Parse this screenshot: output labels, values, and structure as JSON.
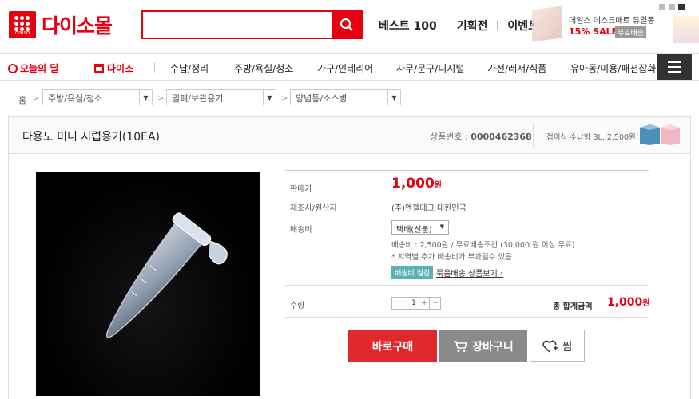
{
  "header": {
    "logo_sub": "daiso",
    "logo_text": "다이소몰",
    "search_placeholder": "",
    "top_links": [
      "베스트 100",
      "기획전",
      "이벤트"
    ],
    "ad_title": "데일스 데스크매트 듀얼퐁",
    "ad_sale": "15% SALE",
    "ad_badge": "무료배송"
  },
  "nav": {
    "today_deal": "오늘의 딜",
    "daiso": "다이소",
    "items": [
      "수납/정리",
      "주방/욕실/청소",
      "가구/인테리어",
      "사무/문구/디지털",
      "가전/레저/식품",
      "유아동/미용/패션잡화"
    ]
  },
  "breadcrumb": {
    "home": "홈",
    "levels": [
      "주방/욕실/청소",
      "밀폐/보관용기",
      "양념통/소스병"
    ]
  },
  "product": {
    "title": "다용도 미니 시럽용기(10EA)",
    "number_label": "상품번호 : ",
    "number": "0000462368",
    "related": "접이식 수납함 3L, 2,500원!"
  },
  "info": {
    "price_label": "판매가",
    "price": "1,000",
    "price_unit": "원",
    "maker_label": "제조사/원산지",
    "maker": "(주)엔젤테크 대한민국",
    "ship_label": "배송비",
    "ship_option": "택배(선불)",
    "ship_detail": "배송비 : 2,500원 / 무료배송조건 (30,000 원 이상 무료)",
    "ship_note": "* 지역별 추가 배송비가 부과될수 있음",
    "ship_tag": "배송비 절감",
    "ship_link": "묶음배송 상품보기",
    "qty_label": "수량",
    "qty": "1",
    "total_label": "총 합계금액",
    "total": "1,000",
    "total_unit": "원"
  },
  "actions": {
    "buy": "바로구매",
    "cart": "장바구니",
    "wish": "찜"
  },
  "colors": {
    "brand": "#e60012",
    "buy": "#e0272a",
    "cart": "#8a8a8a"
  }
}
